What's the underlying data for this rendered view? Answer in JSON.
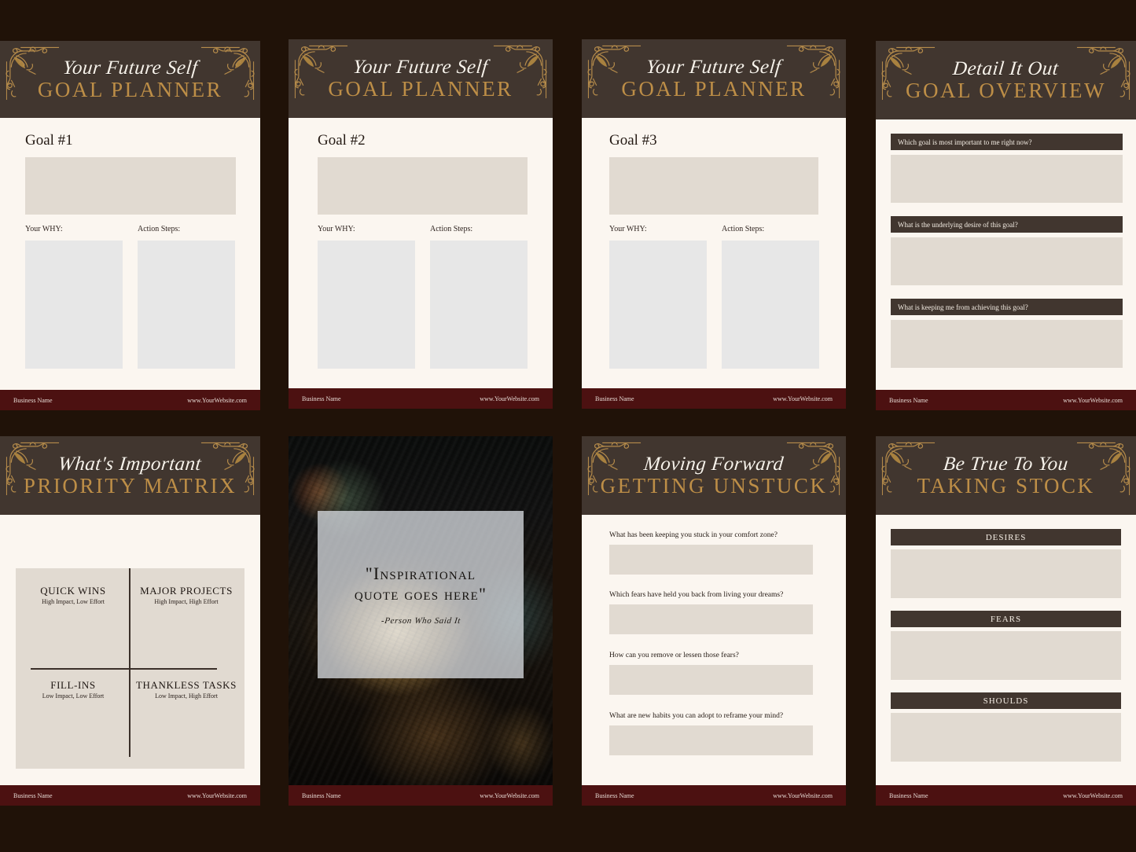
{
  "theme": {
    "page_bg": "#201208",
    "card_bg": "#fbf6f0",
    "header_bg": "#41362f",
    "footer_bg": "#4c1111",
    "gold": "#bd8e47",
    "beige_field": "#e1dad1",
    "gray_field": "#e7e7e7",
    "ink": "#241a14"
  },
  "footer": {
    "business": "Business Name",
    "website": "www.YourWebsite.com"
  },
  "cards": [
    {
      "id": "goal-1",
      "header": {
        "script": "Your Future Self",
        "main": "GOAL PLANNER"
      },
      "goal_title": "Goal #1",
      "why_label": "Your WHY:",
      "action_label": "Action Steps:"
    },
    {
      "id": "goal-2",
      "header": {
        "script": "Your Future Self",
        "main": "GOAL PLANNER"
      },
      "goal_title": "Goal #2",
      "why_label": "Your WHY:",
      "action_label": "Action Steps:"
    },
    {
      "id": "goal-3",
      "header": {
        "script": "Your Future Self",
        "main": "GOAL PLANNER"
      },
      "goal_title": "Goal #3",
      "why_label": "Your WHY:",
      "action_label": "Action Steps:"
    },
    {
      "id": "goal-overview",
      "header": {
        "script": "Detail It Out",
        "main": "GOAL OVERVIEW"
      },
      "questions": [
        "Which goal is most important to me right now?",
        "What is the underlying desire of this goal?",
        "What is keeping me from achieving this goal?"
      ]
    },
    {
      "id": "priority-matrix",
      "header": {
        "script": "What's Important",
        "main": "PRIORITY MATRIX"
      },
      "quadrants": [
        {
          "title": "QUICK WINS",
          "subtitle": "High Impact, Low Effort"
        },
        {
          "title": "MAJOR PROJECTS",
          "subtitle": "High Impact, High Effort"
        },
        {
          "title": "FILL-INS",
          "subtitle": "Low Impact, Low Effort"
        },
        {
          "title": "THANKLESS TASKS",
          "subtitle": "Low Impact, High Effort"
        }
      ]
    },
    {
      "id": "quote",
      "quote_line_1": "\"Inspirational",
      "quote_line_2": "quote goes here\"",
      "author": "-Person Who Said It"
    },
    {
      "id": "getting-unstuck",
      "header": {
        "script": "Moving Forward",
        "main": "GETTING UNSTUCK"
      },
      "questions": [
        "What has been keeping you stuck in your comfort zone?",
        "Which fears have held you back from living your dreams?",
        "How can you remove or lessen those fears?",
        "What are new habits you can adopt to reframe your mind?"
      ]
    },
    {
      "id": "taking-stock",
      "header": {
        "script": "Be True To You",
        "main": "TAKING STOCK"
      },
      "sections": [
        "DESIRES",
        "FEARS",
        "SHOULDS"
      ]
    }
  ]
}
